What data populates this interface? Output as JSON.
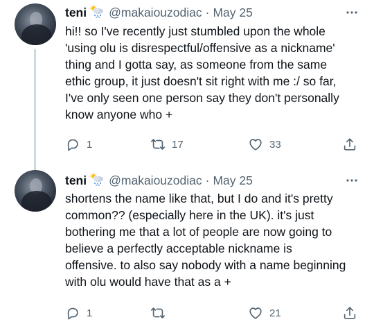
{
  "tweets": [
    {
      "name": "teni",
      "handle": "@makaiouzodiac",
      "separator": "·",
      "date": "May 25",
      "text": "hi!! so I've recently just stumbled upon the whole\n'using olu is disrespectful/offensive as a nickname'\nthing and I gotta say, as someone from the same\nethic group, it just doesn't sit right with me :/ so far,\nI've only seen one person say they don't personally\nknow anyone who +",
      "replies": "1",
      "retweets": "17",
      "likes": "33"
    },
    {
      "name": "teni",
      "handle": "@makaiouzodiac",
      "separator": "·",
      "date": "May 25",
      "text": "shortens the name like that, but I do and it's pretty\ncommon?? (especially here in the UK). it's just\nbothering me that a lot of people are now going to\nbelieve a perfectly acceptable nickname is\noffensive. to also say nobody with a name beginning\nwith olu would have that as a +",
      "replies": "1",
      "retweets": "",
      "likes": "21"
    }
  ],
  "icons": {
    "name_emoji": "cloud-rain-sun-icon",
    "more": "more-horizontal-icon",
    "reply": "reply-icon",
    "retweet": "retweet-icon",
    "like": "heart-icon",
    "share": "share-icon"
  },
  "colors": {
    "text": "#0f1419",
    "secondary": "#536471",
    "thread_line": "#cfd9de"
  }
}
